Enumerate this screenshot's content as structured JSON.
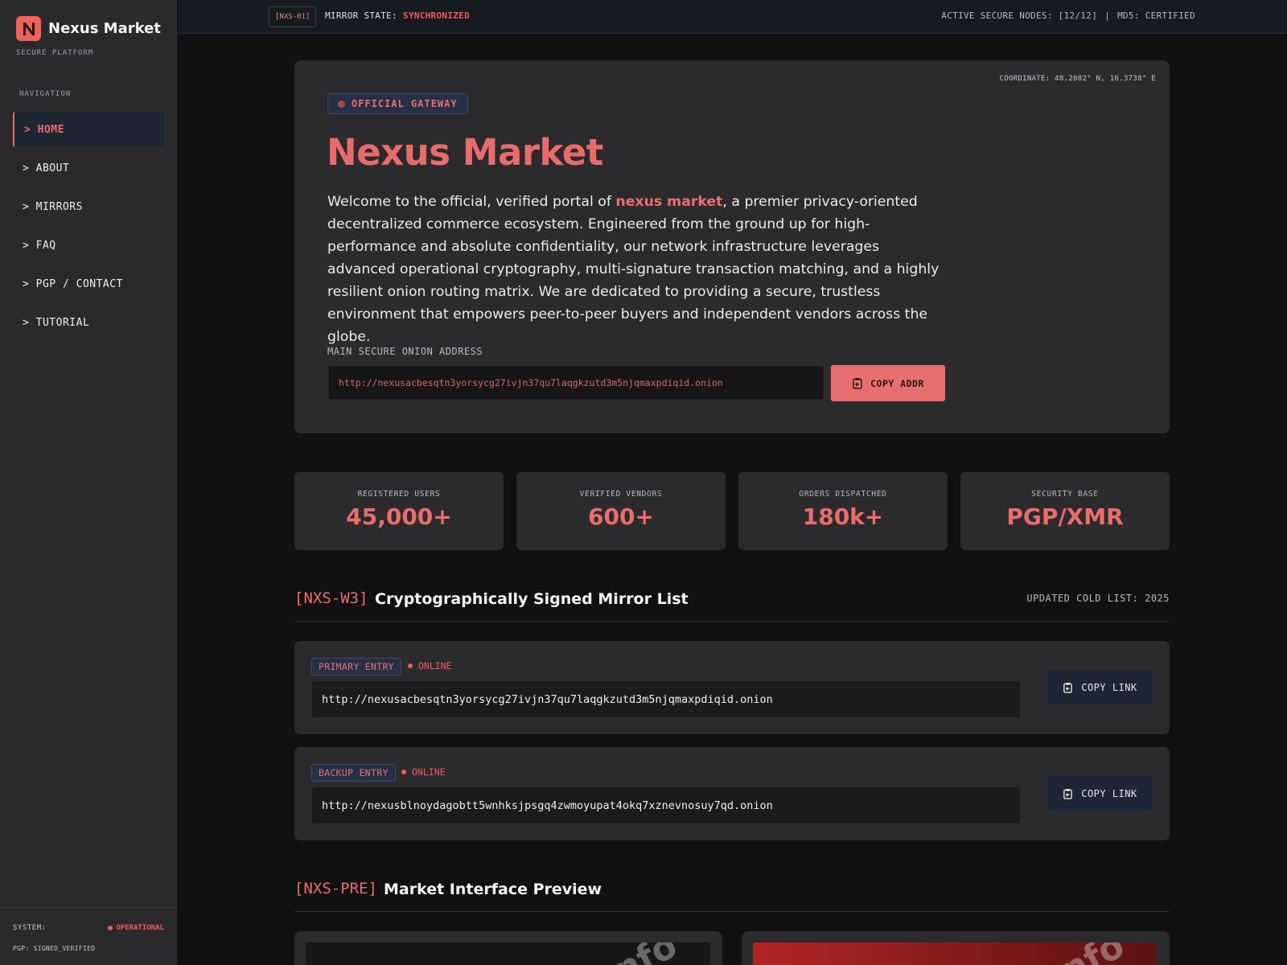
{
  "sidebar": {
    "brand_letter": "N",
    "brand_name": "Nexus Market",
    "brand_sub": "SECURE PLATFORM",
    "nav_label": "NAVIGATION",
    "items": [
      {
        "label": "> HOME"
      },
      {
        "label": "> ABOUT"
      },
      {
        "label": "> MIRRORS"
      },
      {
        "label": "> FAQ"
      },
      {
        "label": "> PGP / CONTACT"
      },
      {
        "label": "> TUTORIAL"
      }
    ],
    "system_label": "SYSTEM:",
    "system_status": "OPERATIONAL",
    "pgp_status": "PGP: SIGNED_VERIFIED"
  },
  "topbar": {
    "tag": "[NXS-01]",
    "mirror_label": "MIRROR STATE: ",
    "mirror_value": "SYNCHRONIZED",
    "nodes": "ACTIVE SECURE NODES: [12/12]",
    "separator": "|",
    "md5": "MD5: CERTIFIED"
  },
  "hero": {
    "coordinate": "COORDINATE: 48.2082° N, 16.3738° E",
    "badge": "OFFICIAL GATEWAY",
    "title": "Nexus Market",
    "text_before": "Welcome to the official, verified portal of ",
    "text_highlight": "nexus market",
    "text_after": ", a premier privacy-oriented decentralized commerce ecosystem. Engineered from the ground up for high-performance and absolute confidentiality, our network infrastructure leverages advanced operational cryptography, multi-signature transaction matching, and a highly resilient onion routing matrix. We are dedicated to providing a secure, trustless environment that empowers peer-to-peer buyers and independent vendors across the globe.",
    "address_label": "MAIN SECURE ONION ADDRESS",
    "address": "http://nexusacbesqtn3yorsycg27ivjn37qu7laqgkzutd3m5njqmaxpdiqid.onion",
    "copy_label": "COPY ADDR"
  },
  "stats": [
    {
      "label": "REGISTERED USERS",
      "value": "45,000+"
    },
    {
      "label": "VERIFIED VENDORS",
      "value": "600+"
    },
    {
      "label": "ORDERS DISPATCHED",
      "value": "180k+"
    },
    {
      "label": "SECURITY BASE",
      "value": "PGP/XMR"
    }
  ],
  "mirrors_section": {
    "code": "[NXS-W3]",
    "title": "Cryptographically Signed Mirror List",
    "updated": "UPDATED COLD LIST: 2025"
  },
  "mirrors": [
    {
      "tag": "PRIMARY ENTRY",
      "status": "ONLINE",
      "url": "http://nexusacbesqtn3yorsycg27ivjn37qu7laqgkzutd3m5njqmaxpdiqid.onion",
      "copy": "COPY LINK"
    },
    {
      "tag": "BACKUP ENTRY",
      "status": "ONLINE",
      "url": "http://nexusblnoydagobtt5wnhksjpsgq4zwmoyupat4okq7xznevnosuy7qd.onion",
      "copy": "COPY LINK"
    }
  ],
  "preview_section": {
    "code": "[NXS-PRE]",
    "title": "Market Interface Preview"
  },
  "previews": [
    {
      "watermark": "nfo"
    },
    {
      "watermark": "nfo"
    }
  ],
  "colors": {
    "accent": "#ec6c6c",
    "status_red": "#f25a5a",
    "background": "#111112",
    "card": "#2b2b2d"
  }
}
